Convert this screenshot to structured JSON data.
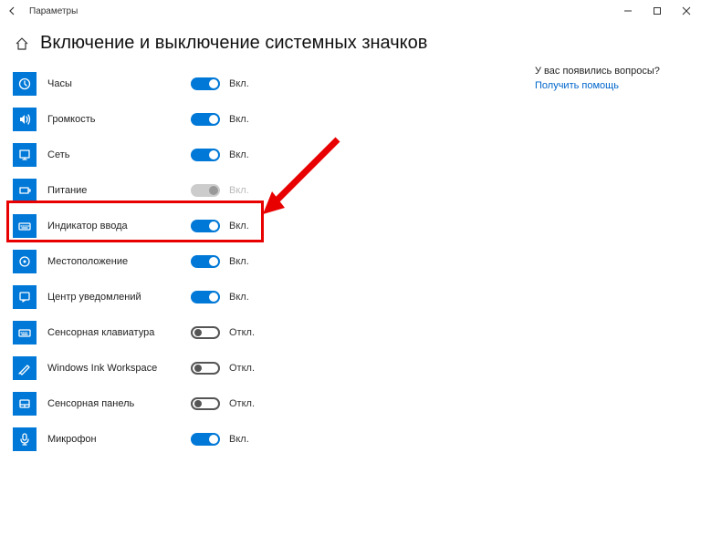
{
  "window_title": "Параметры",
  "page_title": "Включение и выключение системных значков",
  "state_labels": {
    "on": "Вкл.",
    "off": "Откл."
  },
  "help": {
    "question": "У вас появились вопросы?",
    "link": "Получить помощь"
  },
  "items": [
    {
      "key": "clock",
      "label": "Часы",
      "state": "on",
      "icon": "clock"
    },
    {
      "key": "volume",
      "label": "Громкость",
      "state": "on",
      "icon": "volume"
    },
    {
      "key": "network",
      "label": "Сеть",
      "state": "on",
      "icon": "network"
    },
    {
      "key": "power",
      "label": "Питание",
      "state": "disabled",
      "icon": "power"
    },
    {
      "key": "input",
      "label": "Индикатор ввода",
      "state": "on",
      "icon": "keyboard",
      "highlighted": true
    },
    {
      "key": "location",
      "label": "Местоположение",
      "state": "on",
      "icon": "location"
    },
    {
      "key": "action-center",
      "label": "Центр уведомлений",
      "state": "on",
      "icon": "action-center"
    },
    {
      "key": "touch-keyboard",
      "label": "Сенсорная клавиатура",
      "state": "off",
      "icon": "touch-keyboard"
    },
    {
      "key": "ink",
      "label": "Windows Ink Workspace",
      "state": "off",
      "icon": "ink"
    },
    {
      "key": "touchpad",
      "label": "Сенсорная панель",
      "state": "off",
      "icon": "touchpad"
    },
    {
      "key": "microphone",
      "label": "Микрофон",
      "state": "on",
      "icon": "mic"
    }
  ]
}
